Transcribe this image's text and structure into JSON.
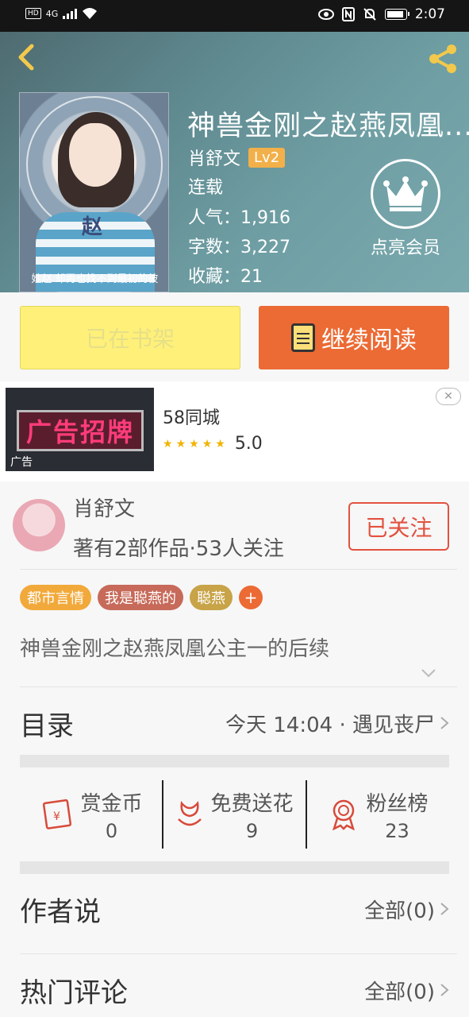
{
  "status_bar": {
    "hd": "HD",
    "network": "4G",
    "time": "2:07"
  },
  "book": {
    "title": "神兽金刚之赵燕凤凰...",
    "author": "肖舒文",
    "level": "Lv2",
    "status": "连载",
    "popularity": "人气：1,916",
    "word_count": "字数：3,227",
    "favorites": "收藏：21",
    "cover_char": "赵",
    "cover_caption": "姓赵 却再也找不到最初的彼"
  },
  "vip": {
    "label": "点亮会员"
  },
  "actions": {
    "shelf_label": "已在书架",
    "read_label": "继续阅读"
  },
  "ad": {
    "image_text": "广告招牌",
    "tag": "广告",
    "brand": "58同城",
    "rating": "5.0",
    "stars": 5
  },
  "author_card": {
    "name": "肖舒文",
    "works": "著有2部作品·53人关注",
    "follow_label": "已关注"
  },
  "tags": [
    "都市言情",
    "我是聪燕的",
    "聪燕"
  ],
  "tag_add": "+",
  "description": "神兽金刚之赵燕凤凰公主一的后续",
  "catalog": {
    "label": "目录",
    "latest": "今天 14:04 · 遇见丧尸"
  },
  "stats": [
    {
      "name": "赏金币",
      "value": "0"
    },
    {
      "name": "免费送花",
      "value": "9"
    },
    {
      "name": "粉丝榜",
      "value": "23"
    }
  ],
  "author_says": {
    "label": "作者说",
    "all": "全部(0)"
  },
  "hot_comments": {
    "label": "热门评论",
    "all": "全部(0)"
  },
  "colors": {
    "accent": "#ec6a34",
    "follow": "#e2523f",
    "shelf": "#fff07a",
    "level_badge": "#f2b04a"
  }
}
